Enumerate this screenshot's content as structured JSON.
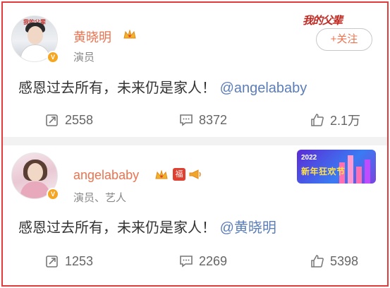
{
  "posts": [
    {
      "author": "黄晓明",
      "subtitle": "演员",
      "text": "感恩过去所有，未来仍是家人！",
      "mention": "@angelababy",
      "follow_label": "+关注",
      "deco_text": "我的父辈",
      "repost_count": "2558",
      "comment_count": "8372",
      "like_count": "2.1万"
    },
    {
      "author": "angelababy",
      "subtitle": "演员、艺人",
      "text": "感恩过去所有，未来仍是家人！",
      "mention": "@黄晓明",
      "badge_fu": "福",
      "deco_year": "2022",
      "deco_title": "新年狂欢节",
      "repost_count": "1253",
      "comment_count": "2269",
      "like_count": "5398"
    }
  ],
  "avatar1_watermark": "我的父辈",
  "colors": {
    "accent": "#eb7350",
    "mention": "#5b7db8",
    "border": "#e23b3b",
    "verified": "#f5a623"
  }
}
